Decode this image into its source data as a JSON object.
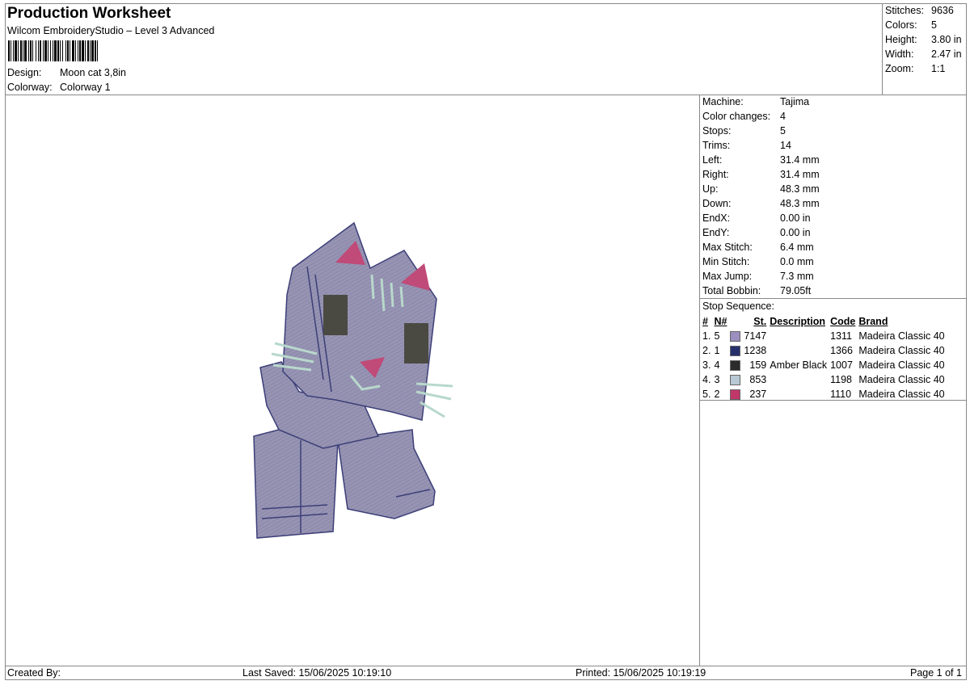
{
  "header": {
    "title": "Production Worksheet",
    "software": "Wilcom EmbroideryStudio – Level 3 Advanced",
    "design_label": "Design:",
    "design_value": "Moon cat 3,8in",
    "colorway_label": "Colorway:",
    "colorway_value": "Colorway 1"
  },
  "summary": [
    {
      "label": "Stitches:",
      "value": "9636"
    },
    {
      "label": "Colors:",
      "value": "5"
    },
    {
      "label": "Height:",
      "value": "3.80 in"
    },
    {
      "label": "Width:",
      "value": "2.47 in"
    },
    {
      "label": "Zoom:",
      "value": "1:1"
    }
  ],
  "machine": [
    {
      "label": "Machine:",
      "value": "Tajima"
    },
    {
      "label": "Color changes:",
      "value": "4"
    },
    {
      "label": "Stops:",
      "value": "5"
    },
    {
      "label": "Trims:",
      "value": "14"
    },
    {
      "label": "Left:",
      "value": "31.4 mm"
    },
    {
      "label": "Right:",
      "value": "31.4 mm"
    },
    {
      "label": "Up:",
      "value": "48.3 mm"
    },
    {
      "label": "Down:",
      "value": "48.3 mm"
    },
    {
      "label": "EndX:",
      "value": "0.00 in"
    },
    {
      "label": "EndY:",
      "value": "0.00 in"
    },
    {
      "label": "Max Stitch:",
      "value": "6.4 mm"
    },
    {
      "label": "Min Stitch:",
      "value": "0.0 mm"
    },
    {
      "label": "Max Jump:",
      "value": "7.3 mm"
    },
    {
      "label": "Total Bobbin:",
      "value": "79.05ft"
    }
  ],
  "stop_sequence": {
    "title": "Stop Sequence:",
    "headers": {
      "hash": "#",
      "n": "N#",
      "st": "St.",
      "description": "Description",
      "code": "Code",
      "brand": "Brand"
    },
    "rows": [
      {
        "idx": "1.",
        "n": "5",
        "color": "#9b8fbf",
        "st": "7147",
        "description": "",
        "code": "1311",
        "brand": "Madeira Classic 40"
      },
      {
        "idx": "2.",
        "n": "1",
        "color": "#27306b",
        "st": "1238",
        "description": "",
        "code": "1366",
        "brand": "Madeira Classic 40"
      },
      {
        "idx": "3.",
        "n": "4",
        "color": "#2b2b2b",
        "st": "159",
        "description": "Amber Black",
        "code": "1007",
        "brand": "Madeira Classic 40"
      },
      {
        "idx": "4.",
        "n": "3",
        "color": "#b8c8d4",
        "st": "853",
        "description": "",
        "code": "1198",
        "brand": "Madeira Classic 40"
      },
      {
        "idx": "5.",
        "n": "2",
        "color": "#c0376a",
        "st": "237",
        "description": "",
        "code": "1110",
        "brand": "Madeira Classic 40"
      }
    ]
  },
  "footer": {
    "created_by": "Created By:",
    "last_saved": "Last Saved: 15/06/2025 10:19:10",
    "printed": "Printed: 15/06/2025 10:19:19",
    "page": "Page 1 of 1"
  }
}
